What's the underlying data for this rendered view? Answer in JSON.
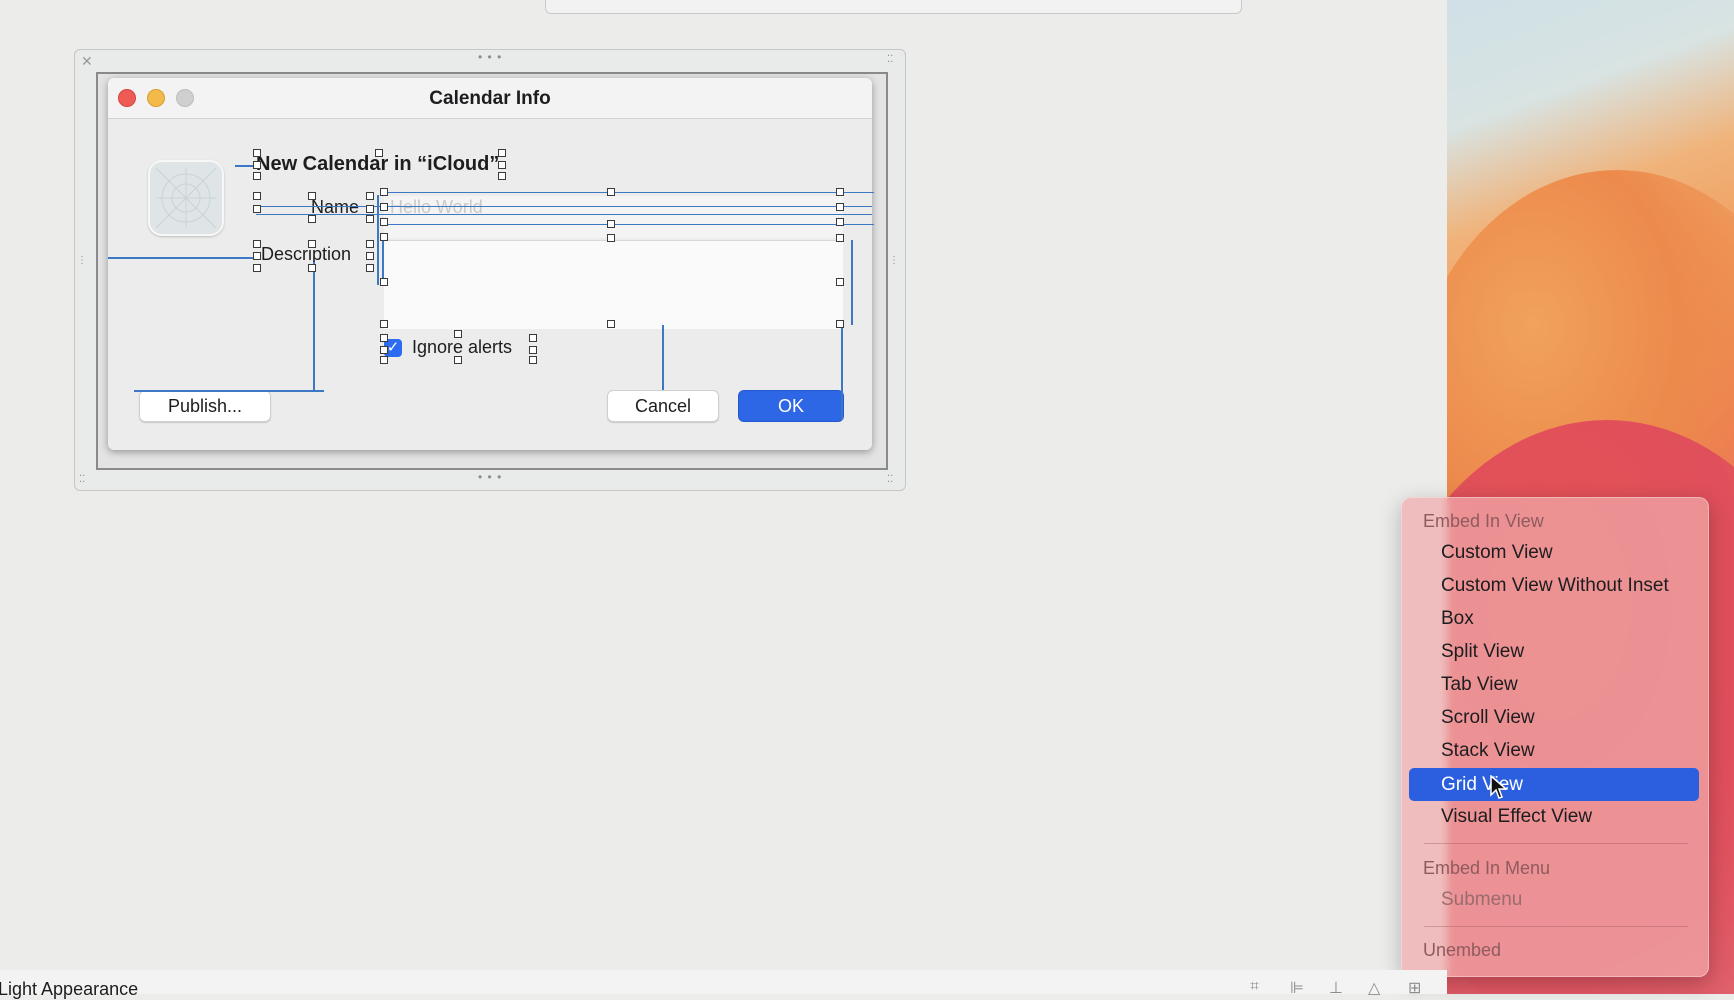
{
  "window": {
    "title": "Calendar Info",
    "heading": "New Calendar in “iCloud”",
    "name_label": "Name",
    "name_placeholder": "Hello World",
    "description_label": "Description",
    "checkbox_label": "Ignore alerts",
    "checkbox_checked": true,
    "publish_button": "Publish...",
    "cancel_button": "Cancel",
    "ok_button": "OK",
    "accent_color": "#2e67e6"
  },
  "context_menu": {
    "section1_title": "Embed In View",
    "items": [
      {
        "label": "Custom View"
      },
      {
        "label": "Custom View Without Inset"
      },
      {
        "label": "Box"
      },
      {
        "label": "Split View"
      },
      {
        "label": "Tab View"
      },
      {
        "label": "Scroll View"
      },
      {
        "label": "Stack View"
      },
      {
        "label": "Grid View",
        "selected": true
      },
      {
        "label": "Visual Effect View"
      }
    ],
    "section2_title": "Embed In Menu",
    "submenu": "Submenu",
    "unembed": "Unembed"
  },
  "bottom_bar": {
    "appearance_label": "Light Appearance"
  }
}
